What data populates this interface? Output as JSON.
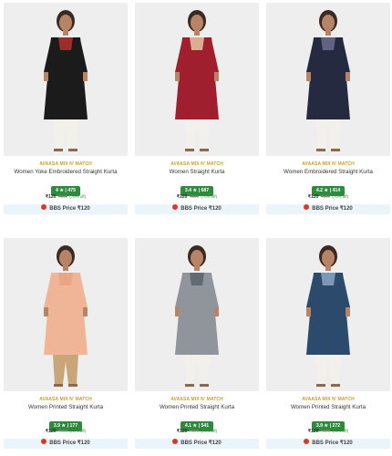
{
  "products": [
    {
      "brand": "AVAASA MIX N' MATCH",
      "title": "Women Yoke Embroidered Straight Kurta",
      "rating": "4 ★ | 475",
      "price": "₹120",
      "mrp": "₹899",
      "discount": "(70% off)",
      "bbs_label": "BBS Price ₹120",
      "kurta_color": "#1b1b1b",
      "bottom_color": "#f2f0ea",
      "accent_color": "#b03030"
    },
    {
      "brand": "AVAASA MIX N' MATCH",
      "title": "Women Straight Kurta",
      "rating": "3.4 ★ | 687",
      "price": "₹120",
      "mrp": "₹599",
      "discount": "(70% off)",
      "bbs_label": "BBS Price ₹120",
      "kurta_color": "#a01f2e",
      "bottom_color": "#f2f0ea",
      "accent_color": "#e8c7a0"
    },
    {
      "brand": "AVAASA MIX N' MATCH",
      "title": "Women Embroidered Straight Kurta",
      "rating": "4.2 ★ | 414",
      "price": "₹120",
      "mrp": "₹699",
      "discount": "(70% off)",
      "bbs_label": "BBS Price ₹120",
      "kurta_color": "#262a40",
      "bottom_color": "#f2f0ea",
      "accent_color": "#6a6f90"
    },
    {
      "brand": "AVAASA MIX N' MATCH",
      "title": "Women Printed Straight Kurta",
      "rating": "3.9 ★ | 177",
      "price": "₹120",
      "mrp": "₹499",
      "discount": "(70% off)",
      "bbs_label": "BBS Price ₹120",
      "kurta_color": "#f0b597",
      "bottom_color": "#c9a67a",
      "accent_color": "#e9a283"
    },
    {
      "brand": "AVAASA MIX N' MATCH",
      "title": "Women Printed Straight Kurta",
      "rating": "4.1 ★ | 541",
      "price": "₹120",
      "mrp": "₹599",
      "discount": "(70% off)",
      "bbs_label": "BBS Price ₹120",
      "kurta_color": "#8f959a",
      "bottom_color": "#f2f0ea",
      "accent_color": "#5c636a"
    },
    {
      "brand": "AVAASA MIX N' MATCH",
      "title": "Women Printed Straight Kurta",
      "rating": "3.9 ★ | 272",
      "price": "₹120",
      "mrp": "₹399",
      "discount": "(70% off)",
      "bbs_label": "BBS Price ₹120",
      "kurta_color": "#2c4a6b",
      "bottom_color": "#f2f0ea",
      "accent_color": "#8aa6c4"
    }
  ],
  "icons": {
    "bbs": "bbs-badge-icon"
  },
  "colors": {
    "brand_text": "#c8a02c",
    "rating_badge": "#2e8b3e",
    "bbs_bg": "#eaf5fb",
    "bbs_dot": "#d9362b"
  }
}
